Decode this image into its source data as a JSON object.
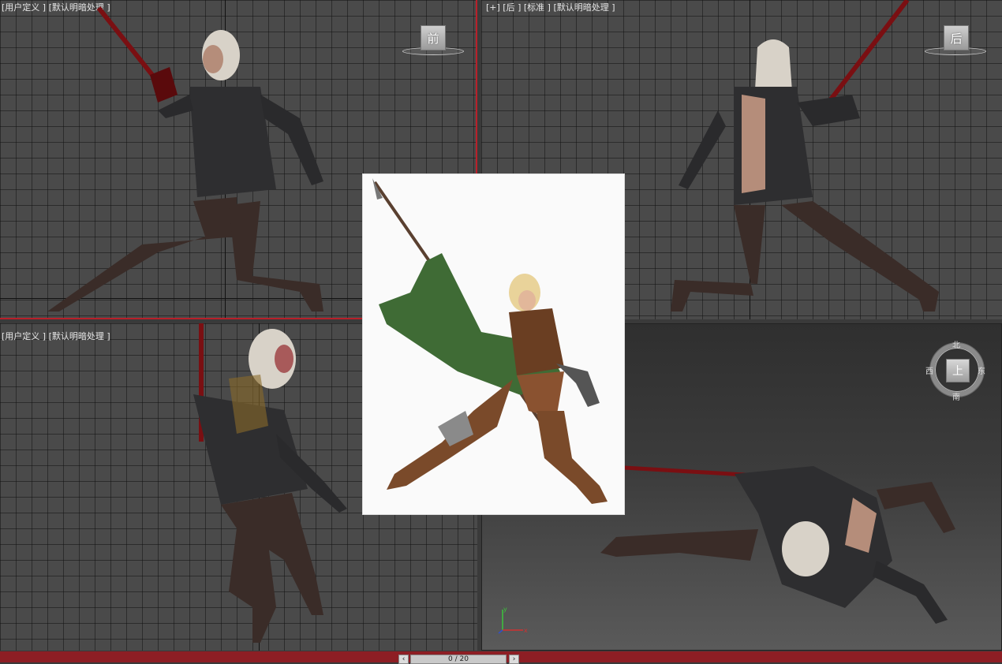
{
  "viewports": {
    "top_left": {
      "label": "[用户定义 ] [默认明暗处理 ]",
      "cube_label": "前"
    },
    "top_right": {
      "label": "[+] [后 ] [标准 ] [默认明暗处理 ]",
      "cube_label": "后"
    },
    "bottom_left": {
      "label": "[用户定义 ] [默认明暗处理 ]"
    },
    "bottom_right": {
      "compass": {
        "center": "上",
        "north": "北",
        "south": "南",
        "east": "东",
        "west": "西"
      },
      "axis_x": "x",
      "axis_y": "y"
    }
  },
  "timeline": {
    "prev_icon": "chevron-left-icon",
    "next_icon": "chevron-right-icon",
    "frame_text": "0 / 20",
    "bar_color": "#8d1e24"
  },
  "colors": {
    "active_border": "#b8202a",
    "grid": "#4a4a4a"
  }
}
